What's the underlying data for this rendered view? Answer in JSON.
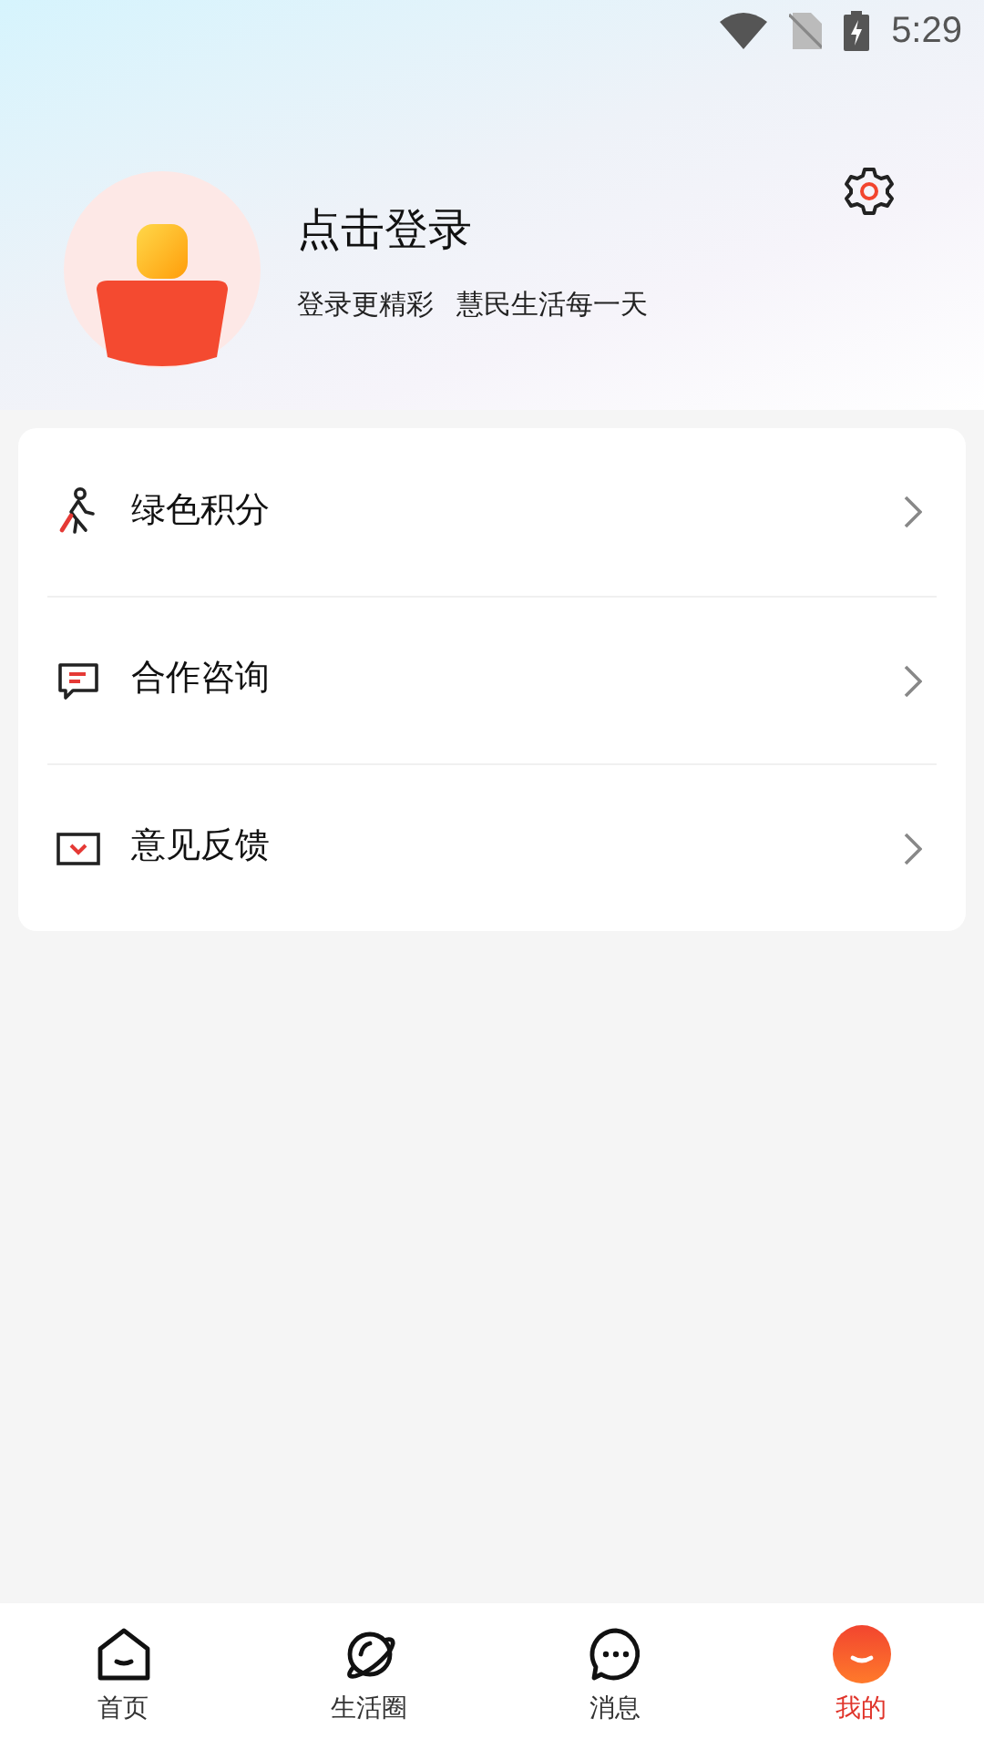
{
  "status_bar": {
    "time": "5:29"
  },
  "profile": {
    "title": "点击登录",
    "subtitle": "登录更精彩   慧民生活每一天"
  },
  "menu": [
    {
      "kind": "walk",
      "label": "绿色积分"
    },
    {
      "kind": "chat",
      "label": "合作咨询"
    },
    {
      "kind": "mail",
      "label": "意见反馈"
    }
  ],
  "nav": [
    {
      "kind": "home",
      "label": "首页",
      "selected": false
    },
    {
      "kind": "planet",
      "label": "生活圈",
      "selected": false
    },
    {
      "kind": "message",
      "label": "消息",
      "selected": false
    },
    {
      "kind": "mine",
      "label": "我的",
      "selected": true
    }
  ]
}
